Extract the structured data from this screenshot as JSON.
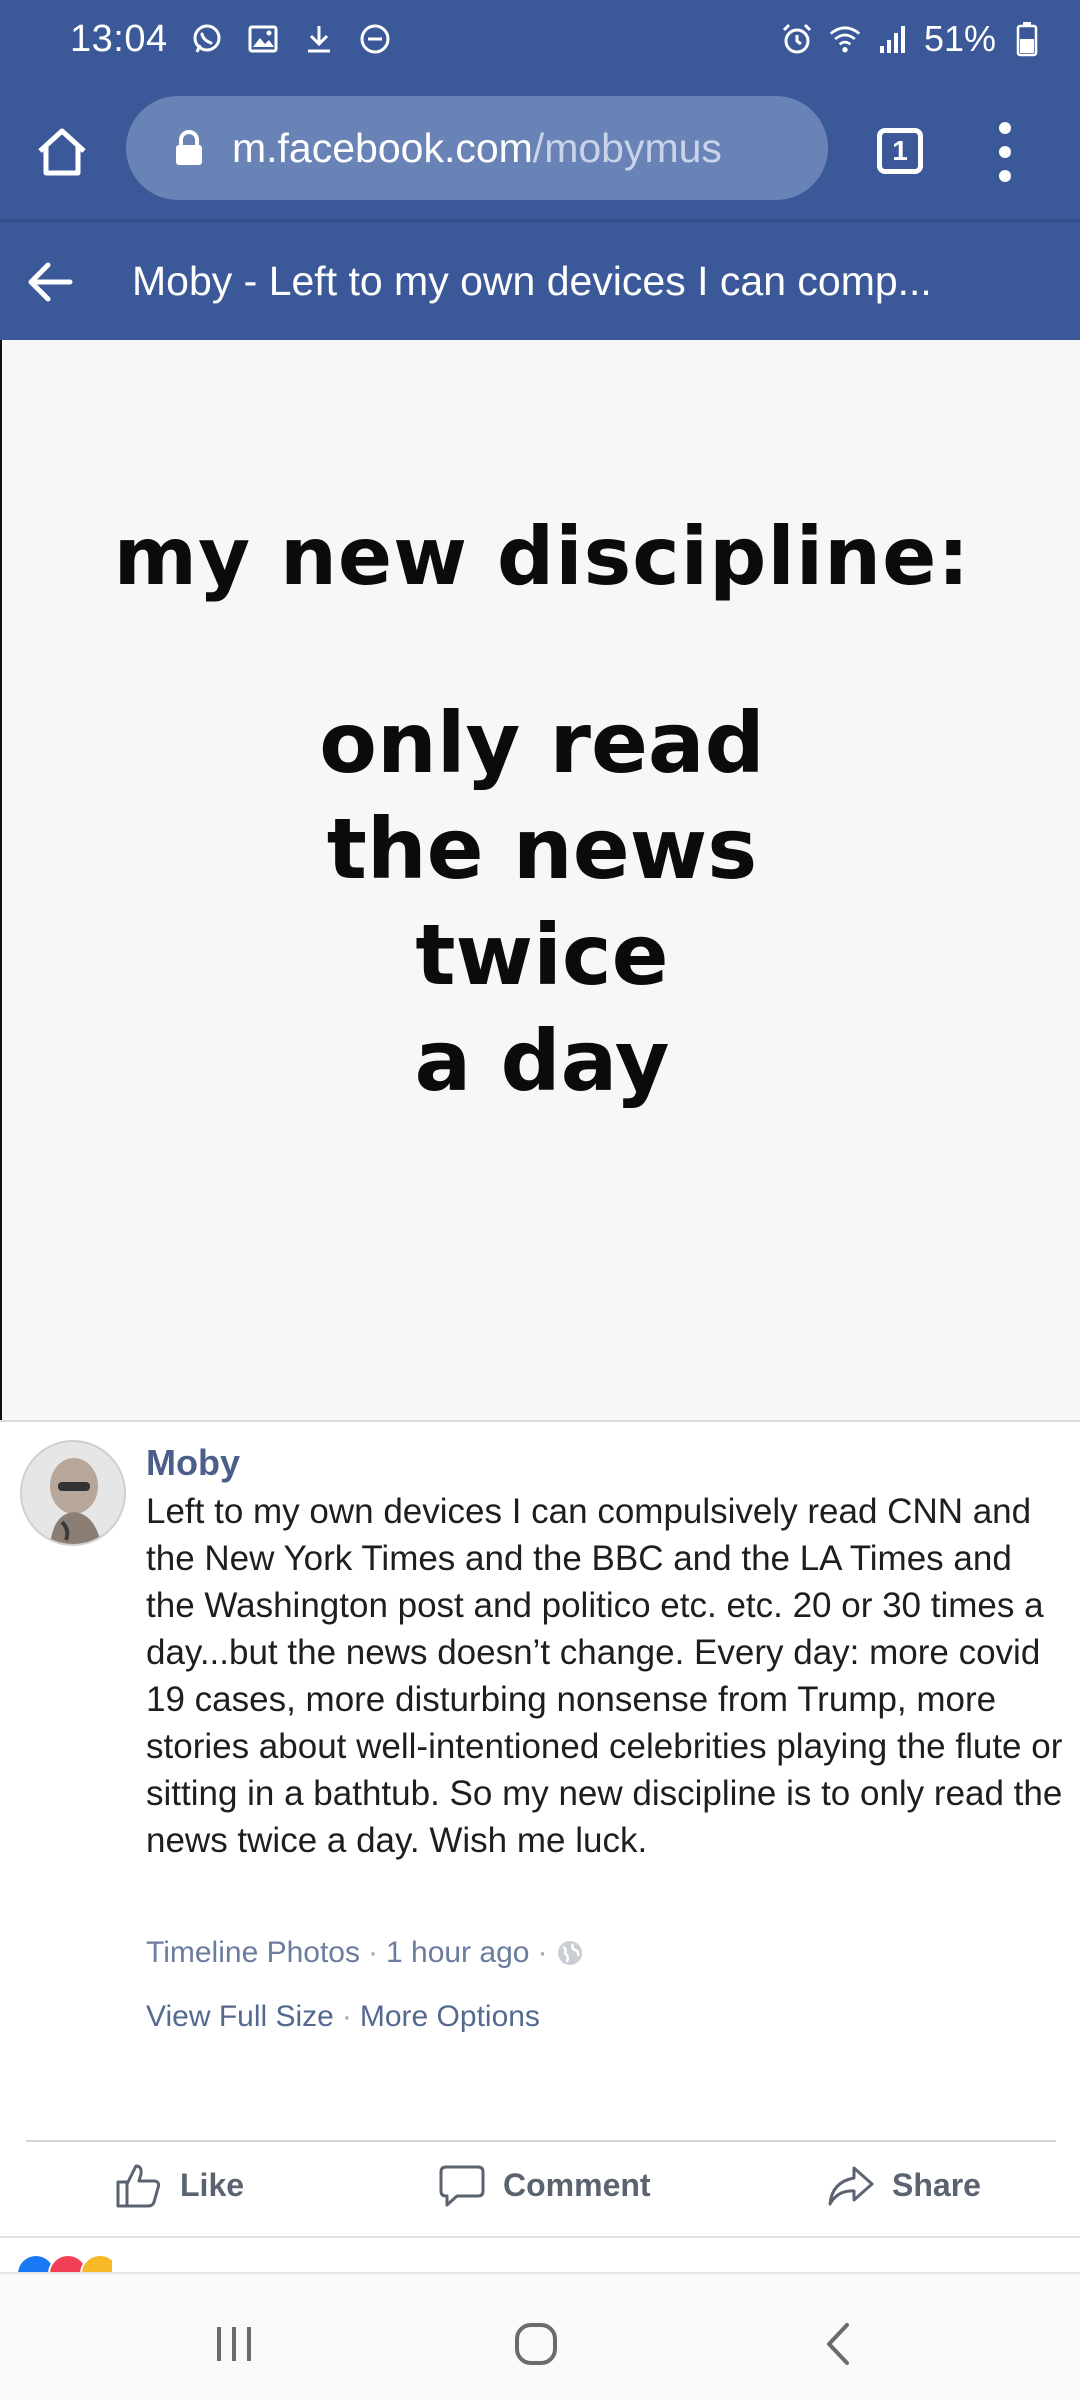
{
  "status_bar": {
    "time": "13:04",
    "left_icons": [
      "whatsapp-icon",
      "image-icon",
      "download-icon",
      "dnd-icon"
    ],
    "right_icons": [
      "alarm-icon",
      "wifi-icon",
      "signal-icon",
      "battery-icon"
    ],
    "battery": "51%"
  },
  "browser": {
    "url_domain": "m.facebook.com",
    "url_path": "/mobymus",
    "tab_count": "1",
    "icons": [
      "home-icon",
      "lock-icon",
      "tabs-icon",
      "more-vert-icon"
    ]
  },
  "page_header": {
    "title": "Moby - Left to my own devices I can comp..."
  },
  "photo": {
    "line1": "my new discipline:",
    "line2": "only read",
    "line3": "the news",
    "line4": "twice",
    "line5": "a day"
  },
  "post": {
    "author": "Moby",
    "body": "Left to my own devices I can compulsively read CNN and the New York Times and the BBC and the LA Times and the Washington post and politico etc. etc. 20 or 30 times a day...but the news doesn’t change. Every day: more covid 19 cases, more disturbing nonsense from Trump, more stories about well-intentioned celebrities playing the flute or sitting in a bathtub. So my new discipline is to only read the news twice a day. Wish me luck.",
    "album": "Timeline Photos",
    "separator": "·",
    "time_ago": "1 hour ago",
    "view_full_size": "View Full Size",
    "more_options": "More Options"
  },
  "actions": {
    "like": "Like",
    "comment": "Comment",
    "share": "Share"
  },
  "colors": {
    "brand_blue": "#3b5998",
    "url_pill": "#6a83b6",
    "link_text": "#55698f",
    "react_like": "#1877f2",
    "react_love": "#f33e58",
    "react_haha": "#f7b928"
  },
  "nav_bar": {
    "icons": [
      "recent-apps-icon",
      "home-circle-icon",
      "back-chevron-icon"
    ]
  }
}
